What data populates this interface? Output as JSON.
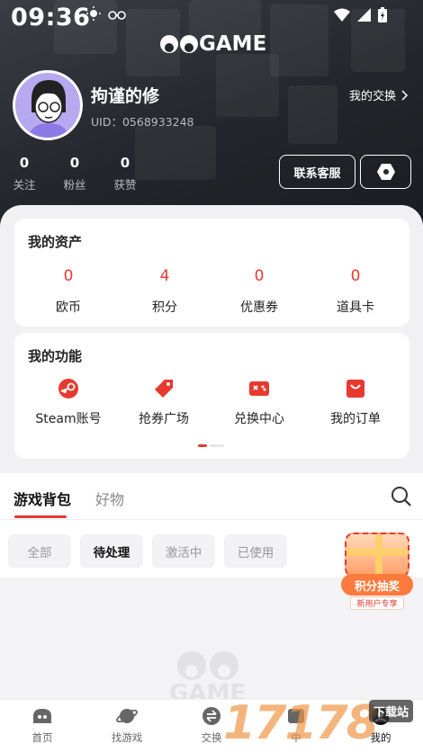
{
  "status_bar": {
    "time": "09:36"
  },
  "brand": {
    "logo_text": "GAME"
  },
  "profile": {
    "name": "拘谨的修",
    "uid": "UID：0568933248",
    "exchange_link": "我的交换"
  },
  "stats": [
    {
      "value": "0",
      "label": "关注"
    },
    {
      "value": "0",
      "label": "粉丝"
    },
    {
      "value": "0",
      "label": "获赞"
    }
  ],
  "actions": {
    "customer_service": "联系客服"
  },
  "assets": {
    "title": "我的资产",
    "items": [
      {
        "value": "0",
        "label": "欧币"
      },
      {
        "value": "4",
        "label": "积分"
      },
      {
        "value": "0",
        "label": "优惠券"
      },
      {
        "value": "0",
        "label": "道具卡"
      }
    ]
  },
  "functions": {
    "title": "我的功能",
    "items": [
      {
        "label": "Steam账号",
        "icon": "steam-icon"
      },
      {
        "label": "抢券广场",
        "icon": "coupon-tag-icon"
      },
      {
        "label": "兑换中心",
        "icon": "gamepad-exchange-icon"
      },
      {
        "label": "我的订单",
        "icon": "shopping-bag-icon"
      }
    ]
  },
  "tabs": {
    "items": [
      "游戏背包",
      "好物"
    ],
    "active": 0
  },
  "filters": {
    "items": [
      "全部",
      "待处理",
      "激活中",
      "已使用"
    ],
    "active": 1
  },
  "promo": {
    "title": "积分抽奖",
    "subtitle": "新用户专享"
  },
  "empty_state": {
    "logo_text": "GAME"
  },
  "bottom_nav": [
    {
      "label": "首页",
      "icon": "home-icon"
    },
    {
      "label": "找游戏",
      "icon": "planet-icon"
    },
    {
      "label": "交换",
      "icon": "exchange-icon"
    },
    {
      "label": "中",
      "icon": "center-icon"
    },
    {
      "label": "我的",
      "icon": "profile-icon"
    }
  ],
  "watermark": {
    "text": "17178",
    "badge": "下载站"
  },
  "colors": {
    "accent": "#e8392f",
    "hero_bg": "#23262c",
    "avatar_bg": "#b6a9f0"
  }
}
